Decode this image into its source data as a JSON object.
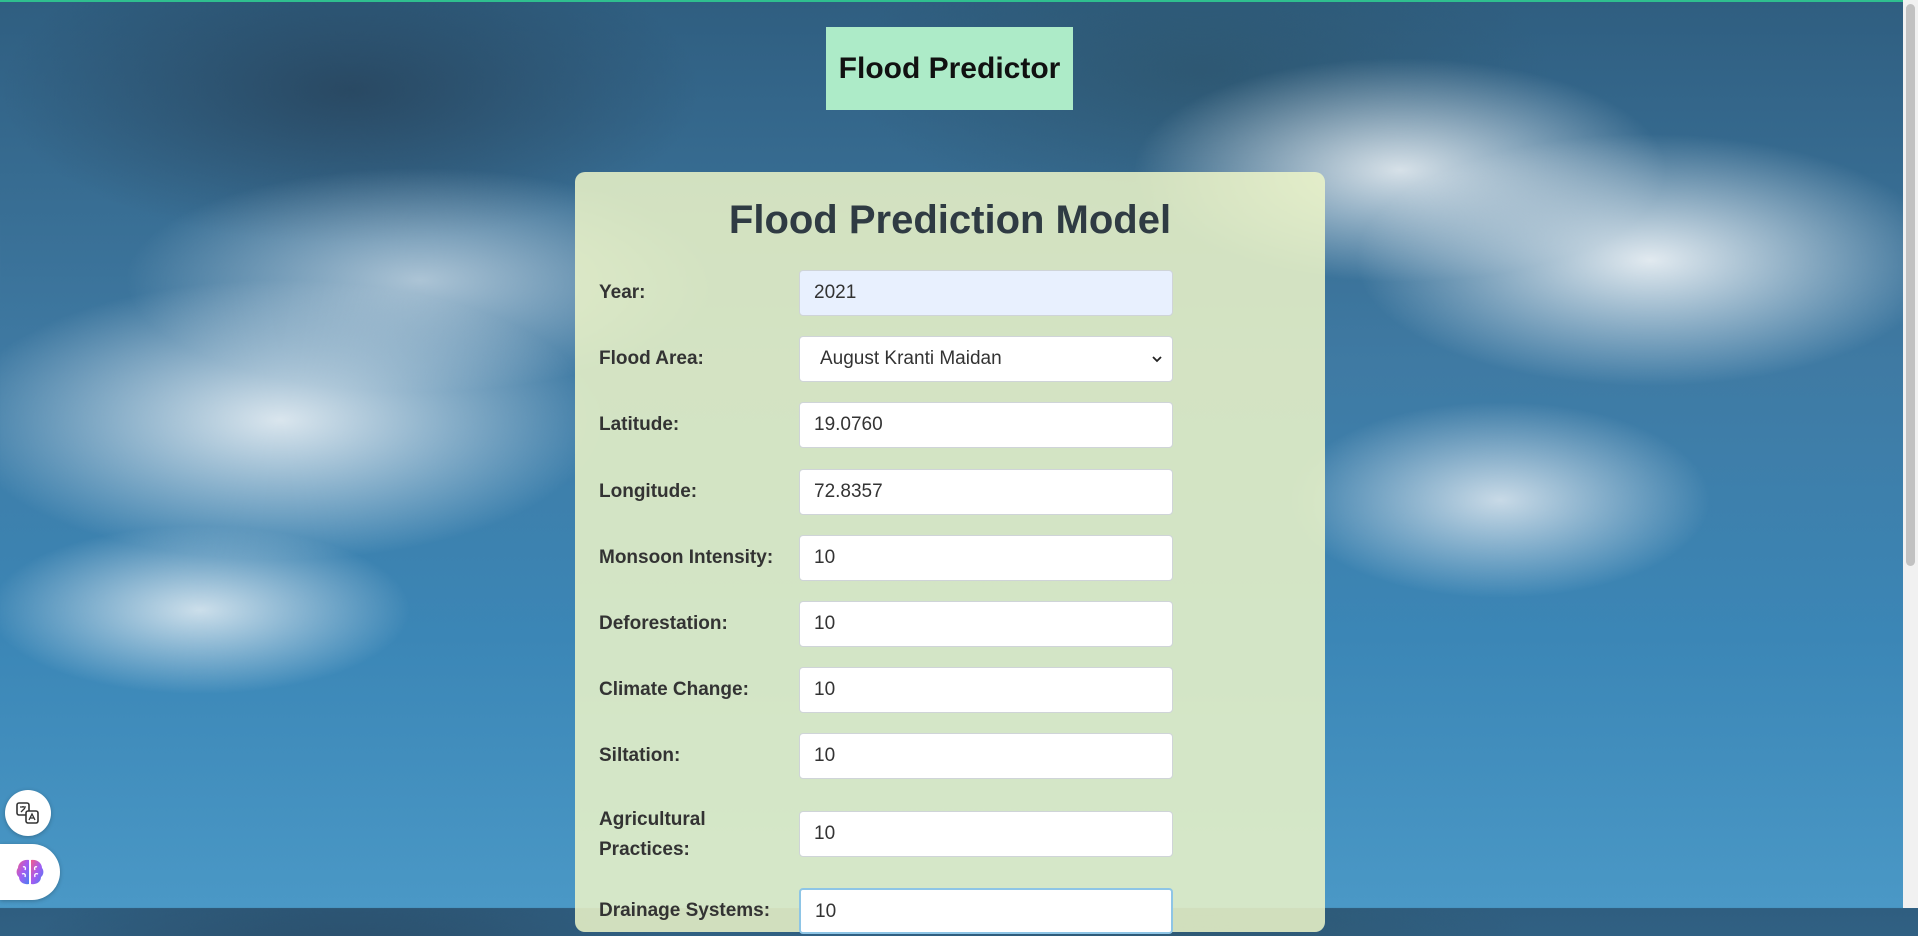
{
  "header": {
    "title": "Flood Predictor"
  },
  "form": {
    "title": "Flood Prediction Model",
    "fields": [
      {
        "label": "Year:",
        "value": "2021"
      },
      {
        "label": "Flood Area:",
        "value": "August Kranti Maidan"
      },
      {
        "label": "Latitude:",
        "value": "19.0760"
      },
      {
        "label": "Longitude:",
        "value": "72.8357"
      },
      {
        "label": "Monsoon Intensity:",
        "value": "10"
      },
      {
        "label": "Deforestation:",
        "value": "10"
      },
      {
        "label": "Climate Change:",
        "value": "10"
      },
      {
        "label": "Siltation:",
        "value": "10"
      },
      {
        "label": "Agricultural Practices:",
        "value": "10"
      },
      {
        "label": "Drainage Systems:",
        "value": "10"
      }
    ]
  },
  "extensions": {
    "translate_icon": "translate-icon",
    "brain_icon": "brain-icon"
  },
  "colors": {
    "header_bg": "#adebc8",
    "card_bg": "#ecf4c8",
    "top_line": "#2fbf8f"
  }
}
